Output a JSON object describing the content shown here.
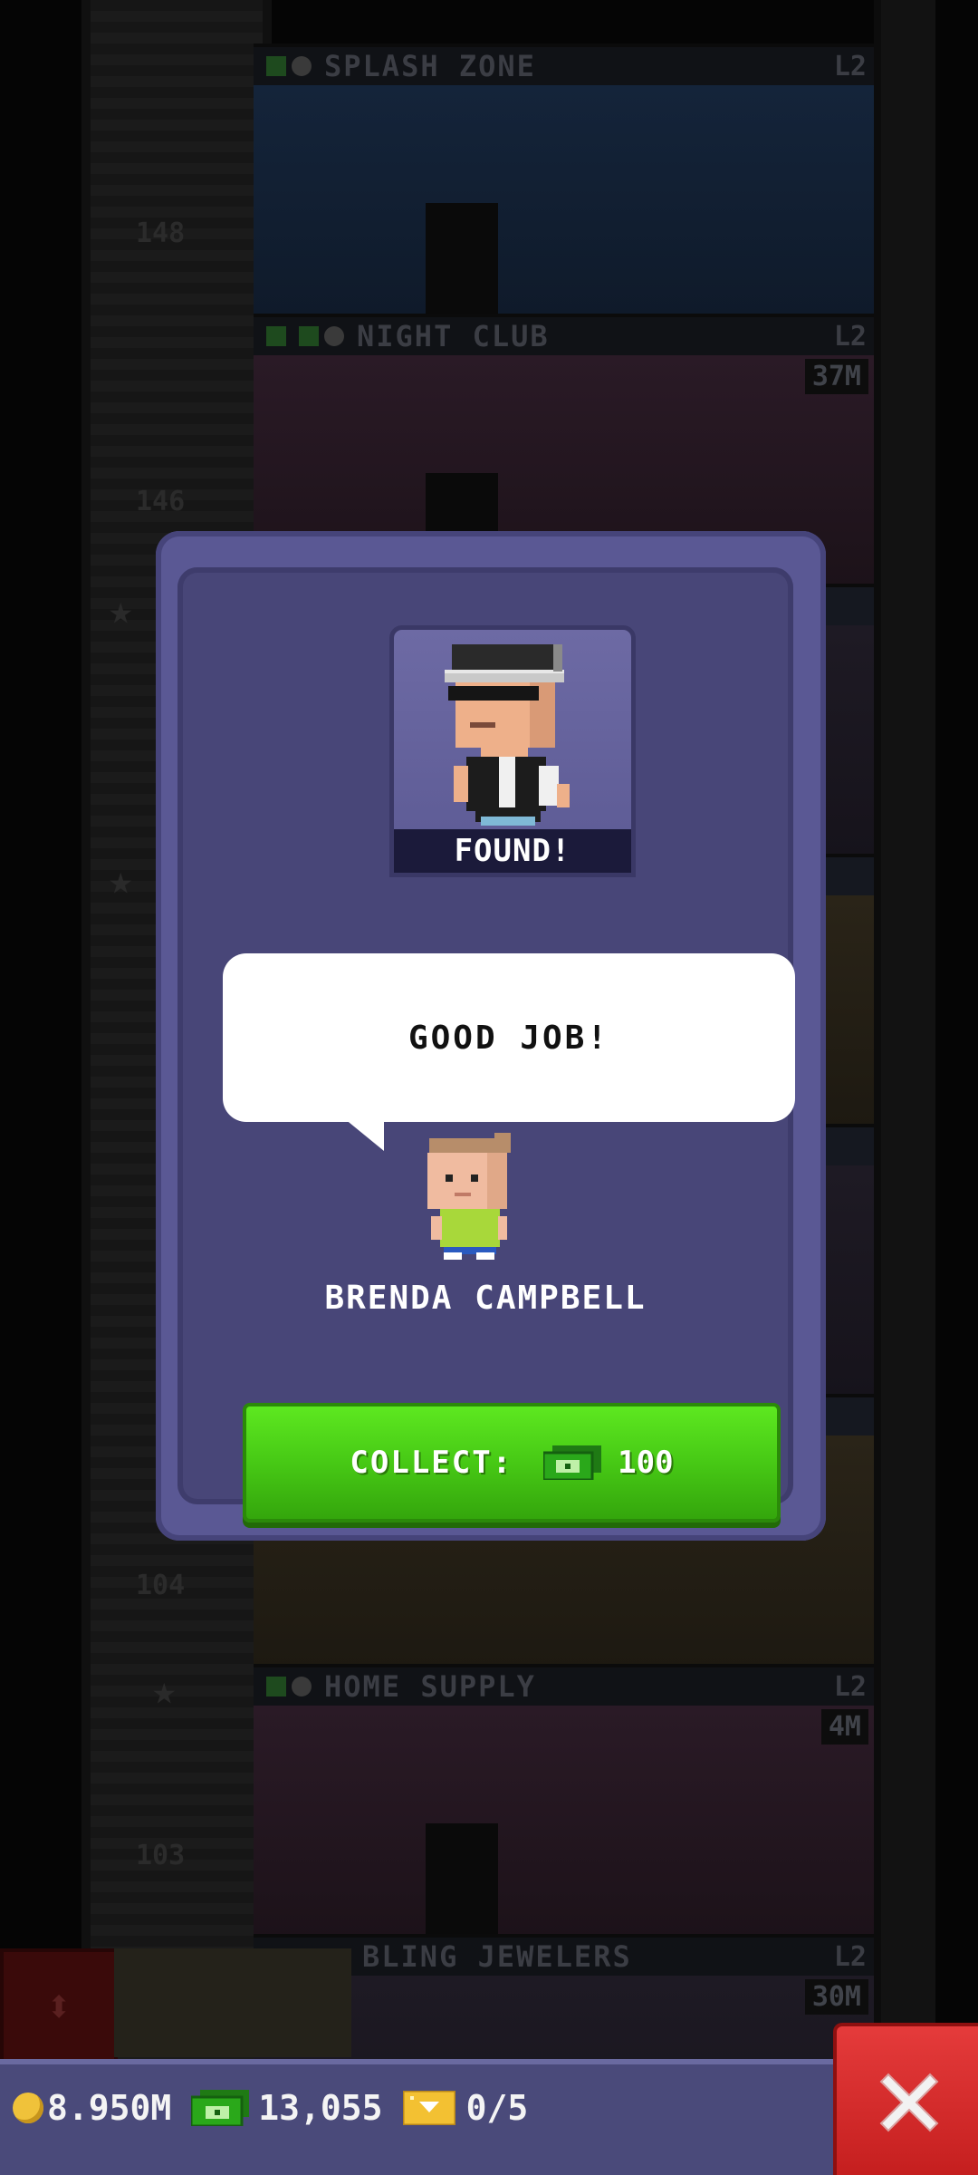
{
  "background": {
    "floors": [
      {
        "name": "SPLASH ZONE",
        "level": "L2",
        "earn": ""
      },
      {
        "name": "NIGHT CLUB",
        "level": "L2",
        "earn": "37M"
      },
      {
        "name": "HOME SUPPLY",
        "level": "L2",
        "earn": "4M"
      },
      {
        "name": "BLING JEWELERS",
        "level": "L2",
        "earn": "30M"
      }
    ],
    "floor_numbers": [
      "148",
      "146",
      "104",
      "103"
    ]
  },
  "dialog": {
    "portrait_status": "FOUND!",
    "speech": "GOOD JOB!",
    "npc_name": "BRENDA CAMPBELL",
    "collect_label": "COLLECT:",
    "collect_amount": "100",
    "collect_currency_icon": "tower-bux-icon"
  },
  "hud": {
    "coins": "8.950M",
    "bux": "13,055",
    "tickets": "0/5"
  },
  "colors": {
    "dialog_bg": "#5a5894",
    "collect_green": "#47c915",
    "close_red": "#d82c2c",
    "bottom_bar": "#4a4a7a"
  }
}
